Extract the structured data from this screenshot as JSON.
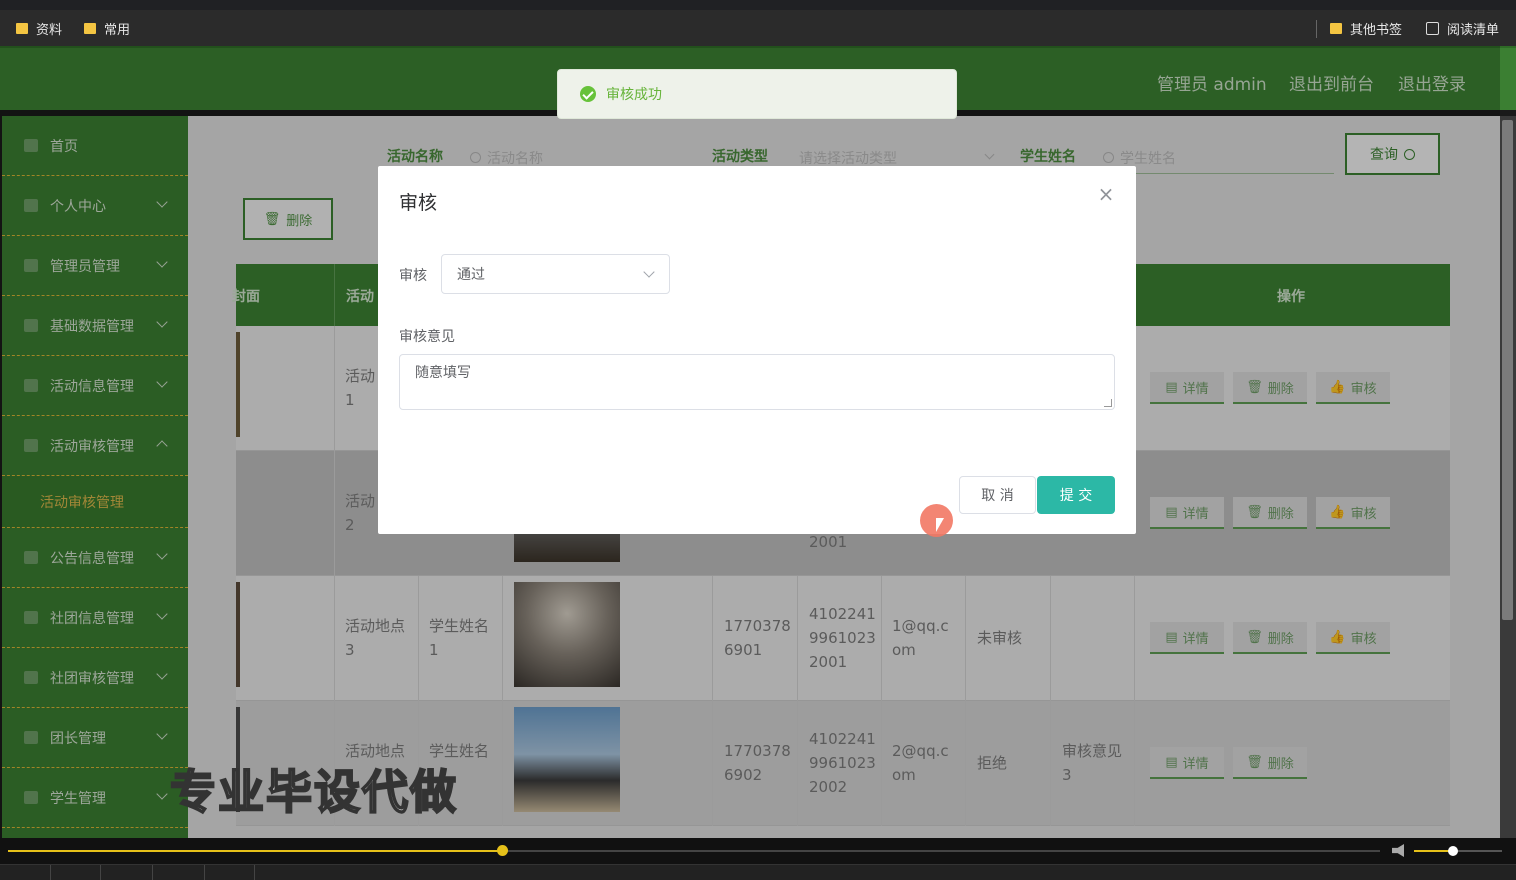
{
  "bookmarks": {
    "left": [
      "资料",
      "常用"
    ],
    "other": "其他书签",
    "reading_list": "阅读清单"
  },
  "header": {
    "user": "管理员 admin",
    "to_front": "退出到前台",
    "logout": "退出登录"
  },
  "sidebar": {
    "items": [
      {
        "label": "首页"
      },
      {
        "label": "个人中心"
      },
      {
        "label": "管理员管理"
      },
      {
        "label": "基础数据管理"
      },
      {
        "label": "活动信息管理"
      },
      {
        "label": "活动审核管理"
      },
      {
        "label": "公告信息管理"
      },
      {
        "label": "社团信息管理"
      },
      {
        "label": "社团审核管理"
      },
      {
        "label": "团长管理"
      },
      {
        "label": "学生管理"
      }
    ],
    "sub_active": "活动审核管理"
  },
  "search": {
    "activity_name_label": "活动名称",
    "activity_name_placeholder": "活动名称",
    "activity_type_label": "活动类型",
    "activity_type_placeholder": "请选择活动类型",
    "student_name_label": "学生姓名",
    "student_name_placeholder": "学生姓名",
    "query_button": "查询"
  },
  "toolbar": {
    "delete_button": "删除"
  },
  "table": {
    "headers": {
      "cover": "封面",
      "activity": "活动",
      "operations": "操作"
    },
    "actions": {
      "detail": "详情",
      "delete": "删除",
      "audit": "审核"
    },
    "rows": [
      {
        "location": "活动\n1",
        "student": "",
        "phone": "",
        "idcard": "",
        "email": "",
        "status": "",
        "opinion": ""
      },
      {
        "location": "活动\n2",
        "student": "",
        "phone": "",
        "idcard": "2001",
        "email": "",
        "status": "",
        "opinion": ""
      },
      {
        "location": "活动地点\n3",
        "student": "学生姓名\n1",
        "phone": "1770378\n6901",
        "idcard": "4102241\n9961023\n2001",
        "email": "1@qq.c\nom",
        "status": "未审核",
        "opinion": ""
      },
      {
        "location": "活动地点",
        "student": "学生姓名",
        "phone": "1770378\n6902",
        "idcard": "4102241\n9961023\n2002",
        "email": "2@qq.c\nom",
        "status": "拒绝",
        "opinion": "审核意见\n3"
      }
    ]
  },
  "toast": {
    "message": "审核成功"
  },
  "dialog": {
    "title": "审核",
    "close": "×",
    "audit_label": "审核",
    "audit_value": "通过",
    "opinion_label": "审核意见",
    "opinion_value": "随意填写",
    "cancel": "取 消",
    "submit": "提 交"
  },
  "watermark": "专业毕设代做",
  "colors": {
    "header_green": "#3b7f32",
    "accent_teal": "#2cb8a6",
    "success": "#67c23a",
    "progress": "#e6c11a"
  },
  "player": {
    "progress": 0.36,
    "volume": 0.43
  }
}
